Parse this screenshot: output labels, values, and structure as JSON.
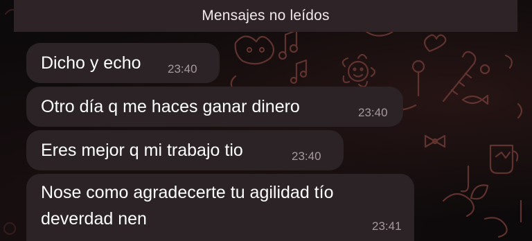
{
  "chat": {
    "unread_label": "Mensajes no leídos",
    "messages": [
      {
        "text": "Dicho y echo",
        "time": "23:40"
      },
      {
        "text": "Otro día q me haces ganar dinero",
        "time": "23:40"
      },
      {
        "text": "Eres mejor q mi trabajo tio",
        "time": "23:40"
      },
      {
        "lines": [
          "Nose como agradecerte tu agilidad tío",
          "deverdad nen"
        ],
        "time": "23:41"
      }
    ]
  },
  "colors": {
    "background": "#0d0a0b",
    "bubble": "#2c2326",
    "unread_bar": "#2e2326",
    "timestamp": "#a69a9c",
    "doodle": "#6e3a36"
  },
  "background_pattern": "doodle-wallpaper"
}
